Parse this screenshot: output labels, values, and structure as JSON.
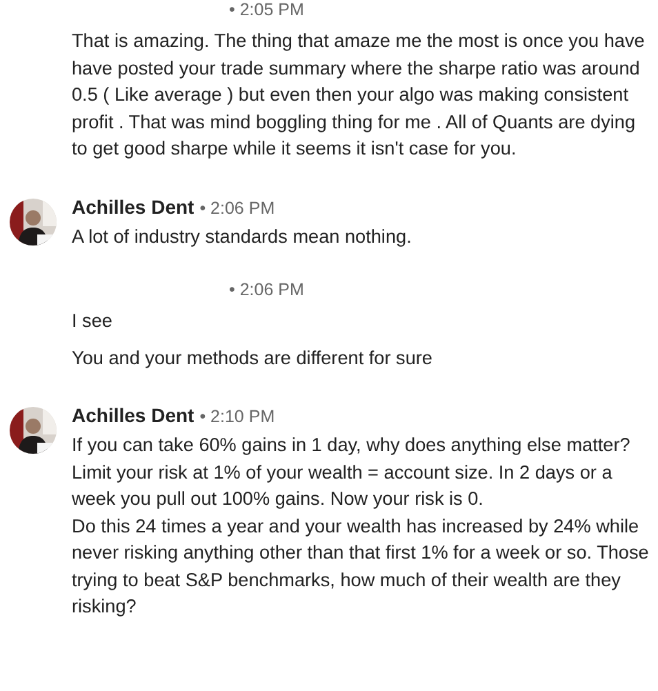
{
  "groups": [
    {
      "kind": "continued",
      "time": "• 2:05 PM",
      "messages": [
        "That is amazing. The thing that amaze me the most is once you have have posted your trade summary where the sharpe ratio was around 0.5 ( Like average ) but even then your algo was making consistent profit . That was mind boggling thing for me . All of Quants are dying to get good sharpe while it seems it isn't case for you."
      ]
    },
    {
      "kind": "named",
      "name": "Achilles Dent",
      "time": "• 2:06 PM",
      "messages": [
        "A lot of industry standards mean nothing."
      ]
    },
    {
      "kind": "continued",
      "time": "• 2:06 PM",
      "messages": [
        "I see",
        "You and your methods are different for sure"
      ]
    },
    {
      "kind": "named",
      "name": "Achilles Dent",
      "time": "• 2:10 PM",
      "messages": [
        "If you can take 60% gains in 1 day, why does anything else matter? Limit your risk at 1% of your wealth = account size. In 2 days or a week you pull out 100% gains. Now your risk is 0.\nDo this 24 times a year and your wealth has increased by 24% while never risking anything other than that first 1% for a week or so. Those trying to beat S&P benchmarks, how much of their wealth are they risking?"
      ]
    }
  ]
}
